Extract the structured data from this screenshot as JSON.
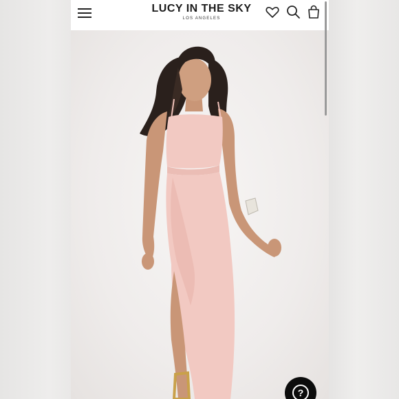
{
  "header": {
    "brand": "LUCY IN THE SKY",
    "brand_sub": "LOS ANGELES",
    "icons": [
      "menu-icon",
      "heart-icon",
      "search-icon",
      "shopping-bag-icon"
    ]
  },
  "hero": {
    "image": "model-in-blush-pink-wrap-maxi-dress",
    "dress_color": "#f2c9c2",
    "background_color": "#f3f1f0"
  },
  "help_button": {
    "label": "?"
  }
}
